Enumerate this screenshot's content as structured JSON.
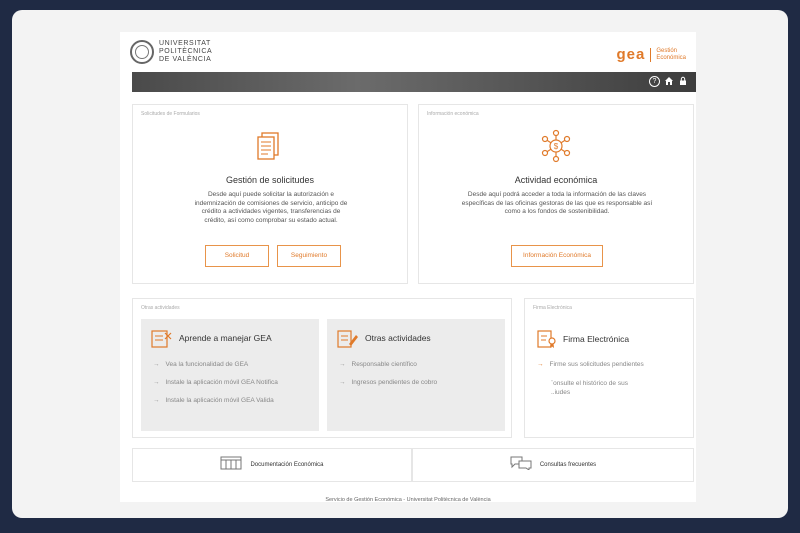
{
  "header": {
    "university": [
      "UNIVERSITAT",
      "POLITÈCNICA",
      "DE VALÈNCIA"
    ],
    "app_name": "gea",
    "app_subtitle": [
      "Gestión",
      "Económica"
    ]
  },
  "toolbar": {
    "help_icon": "help-icon",
    "home_icon": "home-icon",
    "lock_icon": "lock-icon"
  },
  "solicitudes": {
    "caption": "Solicitudes de Formularios",
    "title": "Gestión de solicitudes",
    "description": "Desde aquí puede solicitar la autorización e indemnización de comisiones de servicio, anticipo de crédito a actividades vigentes, transferencias de crédito, así como comprobar su estado actual.",
    "btn_solicitud": "Solicitud",
    "btn_seguimiento": "Seguimiento"
  },
  "economica": {
    "caption": "Información económica",
    "title": "Actividad económica",
    "description": "Desde aquí podrá acceder a toda la información de las claves específicas de las oficinas gestoras de las que es responsable así como a los fondos de sostenibilidad.",
    "btn_info": "Información Económica"
  },
  "otras": {
    "caption": "Otras actividades",
    "aprende": {
      "title": "Aprende a manejar GEA",
      "links": [
        "Vea la funcionalidad de GEA",
        "Instale la aplicación móvil GEA Notifica",
        "Instale la aplicación móvil GEA Valida"
      ]
    },
    "otras_act": {
      "title": "Otras actividades",
      "links": [
        "Responsable científico",
        "Ingresos pendientes de cobro"
      ]
    }
  },
  "firma": {
    "caption": "Firma Electrónica",
    "title": "Firma Electrónica",
    "link1": "Firme sus solicitudes pendientes",
    "link2": "¨onsulte el histórico de sus",
    "link2b": "..iudes"
  },
  "bottom": {
    "documentacion": "Documentación Económica",
    "consultas": "Consultas frecuentes"
  },
  "footer": "Servicio de Gestión Económica - Universitat Politècnica de València",
  "colors": {
    "accent": "#e07a2a",
    "background": "#1f2a44",
    "card": "#ececec"
  }
}
